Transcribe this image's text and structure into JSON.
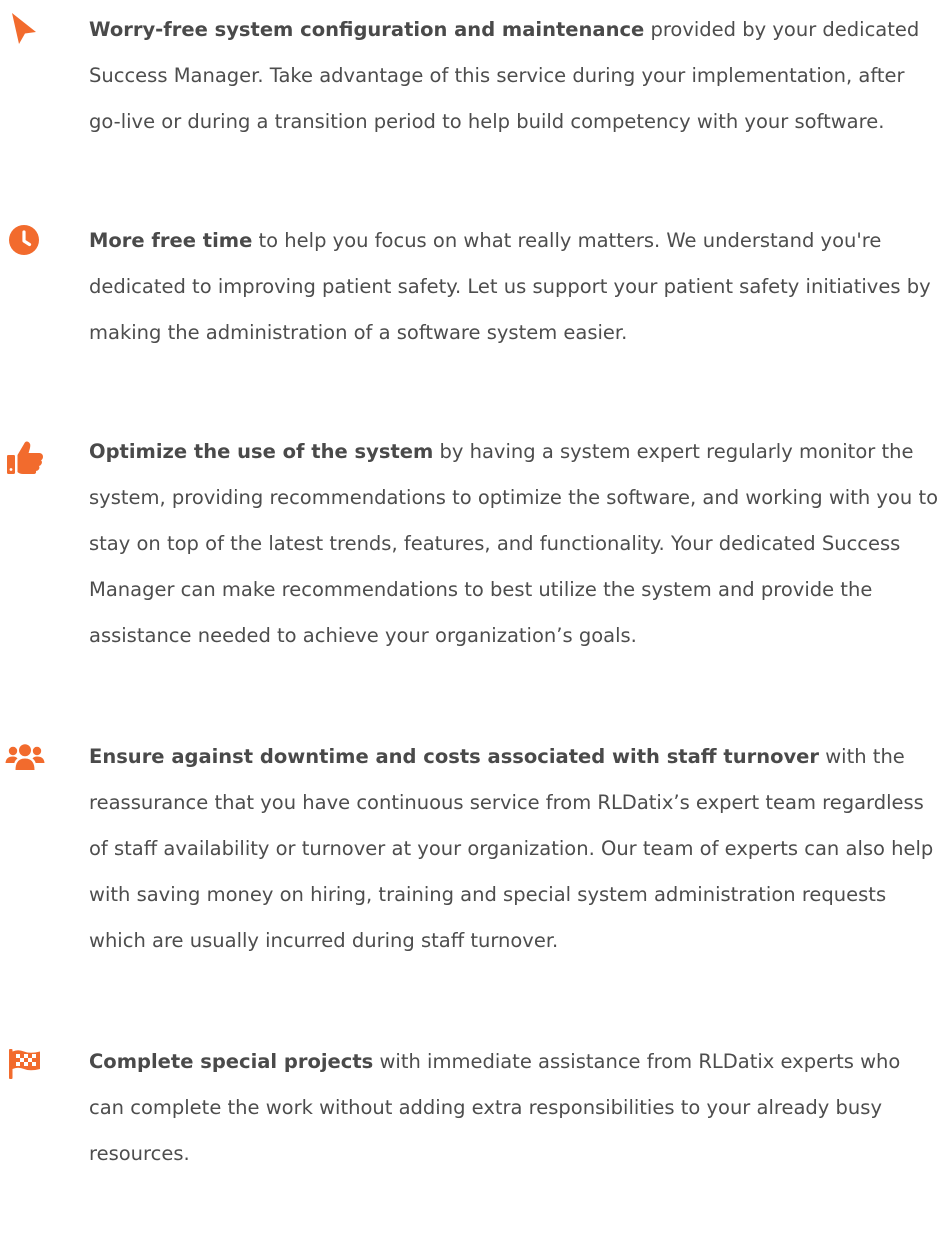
{
  "accent_color": "#f26b2d",
  "benefits": [
    {
      "icon": "cursor-icon",
      "title": "Worry-free system configuration and maintenance",
      "body": " provided by your dedicated Success Manager. Take advantage of this service during your implementation, after go-live or during a transition period to help build competency with your software."
    },
    {
      "icon": "clock-icon",
      "title": "More free time",
      "body": " to help you focus on what really matters. We understand you're dedicated to improving patient safety. Let us support your patient safety initiatives by making the administration of a software system easier."
    },
    {
      "icon": "thumbs-up-icon",
      "title": "Optimize the use of the system",
      "body": " by having a system expert regularly monitor the system, providing recommendations to optimize the software, and working with you to stay on top of the latest trends, features, and functionality. Your dedicated Success Manager can make recommendations to best utilize the system and provide the assistance needed to achieve your organization’s goals."
    },
    {
      "icon": "users-icon",
      "title": "Ensure against downtime and costs associated with staff turnover",
      "body": " with the reassurance that you have continuous service from RLDatix’s expert team regardless of staff availability or turnover at your organization. Our team of experts can also help with saving money on hiring, training and special system administration requests which are usually incurred during staff turnover."
    },
    {
      "icon": "checkered-flag-icon",
      "title": "Complete special projects",
      "body": " with immediate assistance from RLDatix experts who can complete the work without adding extra responsibilities to your already busy resources."
    }
  ]
}
